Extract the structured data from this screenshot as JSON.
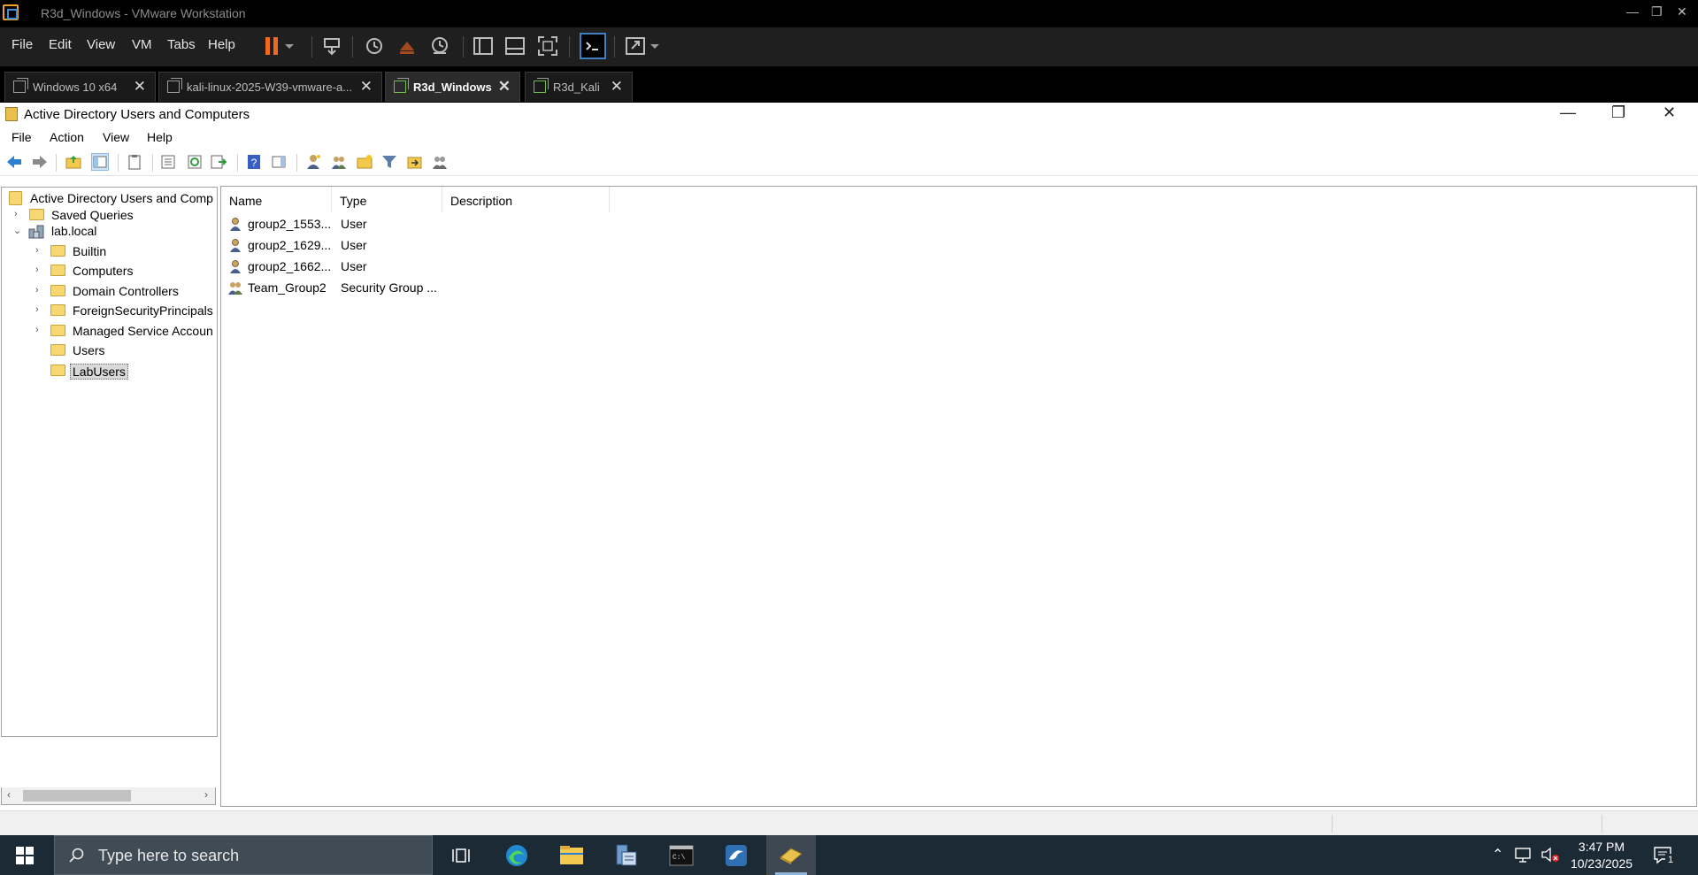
{
  "vmware": {
    "title": "R3d_Windows - VMware Workstation",
    "window_controls": {
      "minimize": "—",
      "restore": "❐",
      "close": "✕"
    },
    "menu": [
      {
        "label": "File"
      },
      {
        "label": "Edit"
      },
      {
        "label": "View"
      },
      {
        "label": "VM"
      },
      {
        "label": "Tabs"
      },
      {
        "label": "Help"
      }
    ],
    "tabs": [
      {
        "label": "Windows 10 x64",
        "active": false
      },
      {
        "label": "kali-linux-2025-W39-vmware-a...",
        "active": false
      },
      {
        "label": "R3d_Windows",
        "active": true
      },
      {
        "label": "R3d_Kali",
        "active": false
      }
    ],
    "tab_close_glyph": "✕",
    "accent_color": "#f06a1e"
  },
  "aduc": {
    "title": "Active Directory Users and Computers",
    "window_controls": {
      "minimize": "—",
      "restore": "❐",
      "close": "✕"
    },
    "menu": [
      {
        "label": "File"
      },
      {
        "label": "Action"
      },
      {
        "label": "View"
      },
      {
        "label": "Help"
      }
    ],
    "tree": {
      "root": "Active Directory Users and Comp",
      "saved_queries": "Saved Queries",
      "domain": "lab.local",
      "children": [
        {
          "label": "Builtin",
          "expandable": true
        },
        {
          "label": "Computers",
          "expandable": true
        },
        {
          "label": "Domain Controllers",
          "expandable": true
        },
        {
          "label": "ForeignSecurityPrincipals",
          "expandable": true
        },
        {
          "label": "Managed Service Accoun",
          "expandable": true
        },
        {
          "label": "Users",
          "expandable": false
        },
        {
          "label": "LabUsers",
          "expandable": false,
          "selected": true
        }
      ],
      "expand_glyph": "›",
      "collapse_glyph": "⌄"
    },
    "list": {
      "columns": [
        "Name",
        "Type",
        "Description"
      ],
      "rows": [
        {
          "name": "group2_1553...",
          "type": "User",
          "description": "",
          "icon": "user-icon"
        },
        {
          "name": "group2_1629...",
          "type": "User",
          "description": "",
          "icon": "user-icon"
        },
        {
          "name": "group2_1662...",
          "type": "User",
          "description": "",
          "icon": "user-icon"
        },
        {
          "name": "Team_Group2",
          "type": "Security Group ...",
          "description": "",
          "icon": "group-icon"
        }
      ]
    }
  },
  "taskbar": {
    "search_placeholder": "Type here to search",
    "time": "3:47 PM",
    "date": "10/23/2025",
    "notification_count": "1"
  }
}
